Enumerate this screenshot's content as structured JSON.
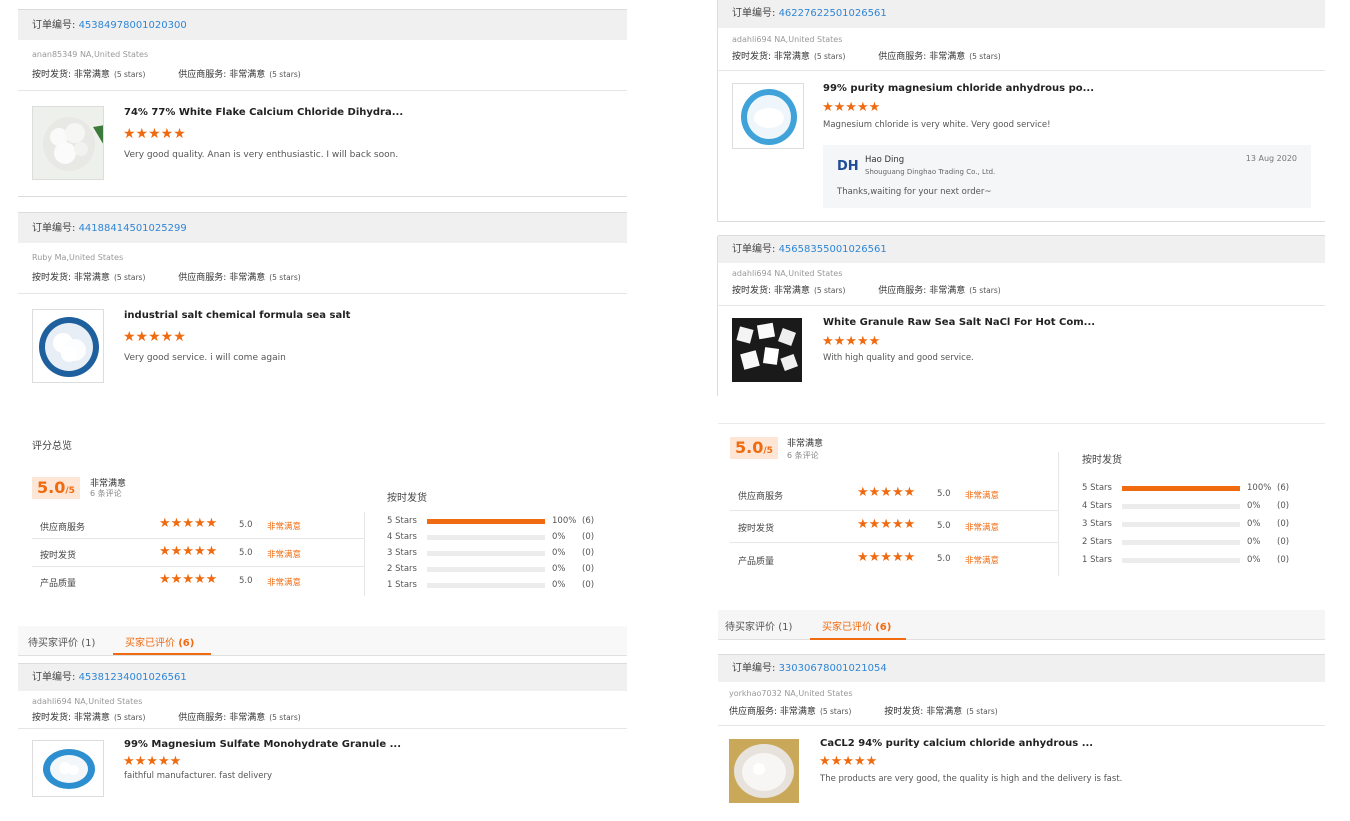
{
  "labels": {
    "order_no": "订单编号:",
    "on_time": "按时发货:",
    "supplier_service": "供应商服务:",
    "very_satisfied": "非常满意",
    "five_stars": "(5 stars)",
    "stars_glyph": "★★★★★"
  },
  "cards": [
    {
      "order_number": "45384978001020300",
      "buyer": "anan85349 NA,United States",
      "product_title": "74% 77% White Flake Calcium Chloride Dihydra...",
      "comment": "Very good quality. Anan is very enthusiastic. I will back soon.",
      "rating": 5
    },
    {
      "order_number": "44188414501025299",
      "buyer": "Ruby Ma,United States",
      "product_title": "industrial salt chemical formula sea salt",
      "comment": "Very good service. i will come again",
      "rating": 5
    },
    {
      "order_number": "46227622501026561",
      "buyer": "adahli694 NA,United States",
      "product_title": "99% purity magnesium chloride anhydrous po...",
      "comment": "Magnesium chloride is very white.  Very good service!",
      "rating": 5,
      "reply": {
        "avatar_initials": "DH",
        "name": "Hao Ding",
        "company": "Shouguang Dinghao Trading Co., Ltd.",
        "date": "13 Aug 2020",
        "text": "Thanks,waiting for your next order~"
      }
    },
    {
      "order_number": "45658355001026561",
      "buyer": "adahli694 NA,United States",
      "product_title": "White Granule Raw Sea Salt NaCl For Hot Com...",
      "comment": "With high quality and good service.",
      "rating": 5
    },
    {
      "order_number": "45381234001026561",
      "buyer": "adahli694 NA,United States",
      "product_title": "99% Magnesium Sulfate Monohydrate Granule ...",
      "comment": "faithful manufacturer. fast delivery",
      "rating": 5
    },
    {
      "order_number": "33030678001021054",
      "buyer": "yorkhao7032 NA,United States",
      "product_title": "CaCL2 94% purity calcium chloride anhydrous ...",
      "comment": "The products are very good, the quality is high and the delivery is fast.",
      "rating": 5
    }
  ],
  "summary": {
    "title": "评分总览",
    "score": "5.0",
    "score_suffix": "/5",
    "score_label": "非常满意",
    "review_count": "6 条评论",
    "dimensions": [
      {
        "label": "供应商服务",
        "value": "5.0",
        "level": "非常满意"
      },
      {
        "label": "按时发货",
        "value": "5.0",
        "level": "非常满意"
      },
      {
        "label": "产品质量",
        "value": "5.0",
        "level": "非常满意"
      }
    ],
    "distribution_title": "按时发货",
    "distribution": [
      {
        "label": "5 Stars",
        "percent": 100,
        "pct_text": "100%",
        "count": "(6)"
      },
      {
        "label": "4 Stars",
        "percent": 0,
        "pct_text": "0%",
        "count": "(0)"
      },
      {
        "label": "3 Stars",
        "percent": 0,
        "pct_text": "0%",
        "count": "(0)"
      },
      {
        "label": "2 Stars",
        "percent": 0,
        "pct_text": "0%",
        "count": "(0)"
      },
      {
        "label": "1 Stars",
        "percent": 0,
        "pct_text": "0%",
        "count": "(0)"
      }
    ]
  },
  "tabs": [
    {
      "label": "待买家评价",
      "count": "(1)"
    },
    {
      "label": "买家已评价",
      "count": "(6)",
      "active": true
    }
  ],
  "colors": {
    "accent": "#f06a0f",
    "link": "#2f86d6",
    "bar_bg": "#f0f0f0"
  }
}
